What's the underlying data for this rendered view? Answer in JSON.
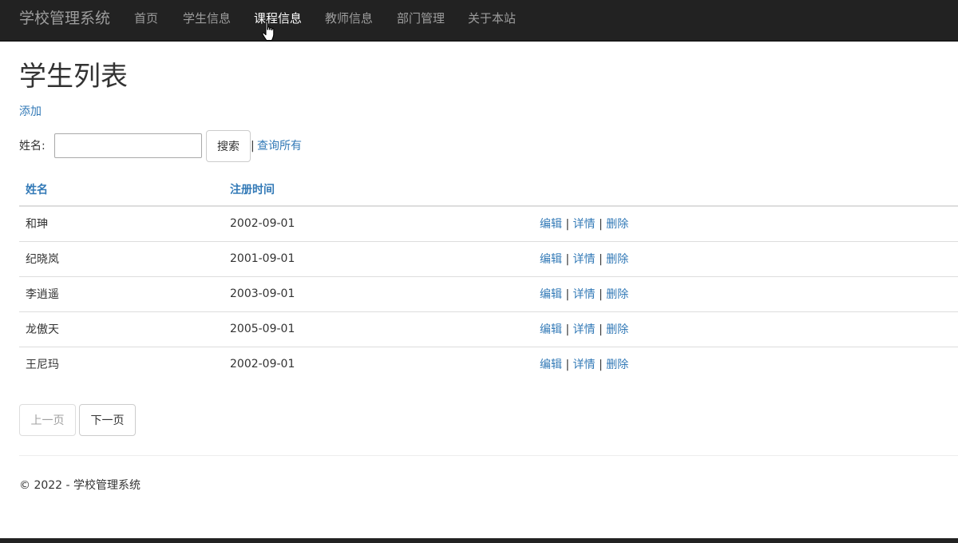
{
  "navbar": {
    "brand": "学校管理系统",
    "items": [
      {
        "label": "首页"
      },
      {
        "label": "学生信息"
      },
      {
        "label": "课程信息"
      },
      {
        "label": "教师信息"
      },
      {
        "label": "部门管理"
      },
      {
        "label": "关于本站"
      }
    ],
    "hovered_item": "课程信息",
    "colors": {
      "background": "#222222",
      "text": "#9d9d9d",
      "hover_text": "#ffffff"
    }
  },
  "page": {
    "title": "学生列表",
    "add_link": "添加"
  },
  "search": {
    "label": "姓名:",
    "value": "",
    "button_label": "搜索",
    "separator": "|",
    "query_all_link": "查询所有"
  },
  "table": {
    "headers": {
      "name": "姓名",
      "date": "注册时间"
    },
    "rows": [
      {
        "name": "和珅",
        "date": "2002-09-01",
        "edit": "编辑",
        "sep1": "|",
        "details": "详情",
        "sep2": "|",
        "delete": "删除"
      },
      {
        "name": "纪晓岚",
        "date": "2001-09-01",
        "edit": "编辑",
        "sep1": "|",
        "details": "详情",
        "sep2": "|",
        "delete": "删除"
      },
      {
        "name": "李逍遥",
        "date": "2003-09-01",
        "edit": "编辑",
        "sep1": "|",
        "details": "详情",
        "sep2": "|",
        "delete": "删除"
      },
      {
        "name": "龙傲天",
        "date": "2005-09-01",
        "edit": "编辑",
        "sep1": "|",
        "details": "详情",
        "sep2": "|",
        "delete": "删除"
      },
      {
        "name": "王尼玛",
        "date": "2002-09-01",
        "edit": "编辑",
        "sep1": "|",
        "details": "详情",
        "sep2": "|",
        "delete": "删除"
      }
    ]
  },
  "pagination": {
    "prev_label": "上一页",
    "next_label": "下一页",
    "prev_disabled": true
  },
  "footer": {
    "text": "© 2022 - 学校管理系统"
  },
  "colors": {
    "link": "#337ab7",
    "text": "#333333",
    "border": "#dddddd"
  },
  "icons": {
    "cursor": "hand-pointer-icon"
  }
}
